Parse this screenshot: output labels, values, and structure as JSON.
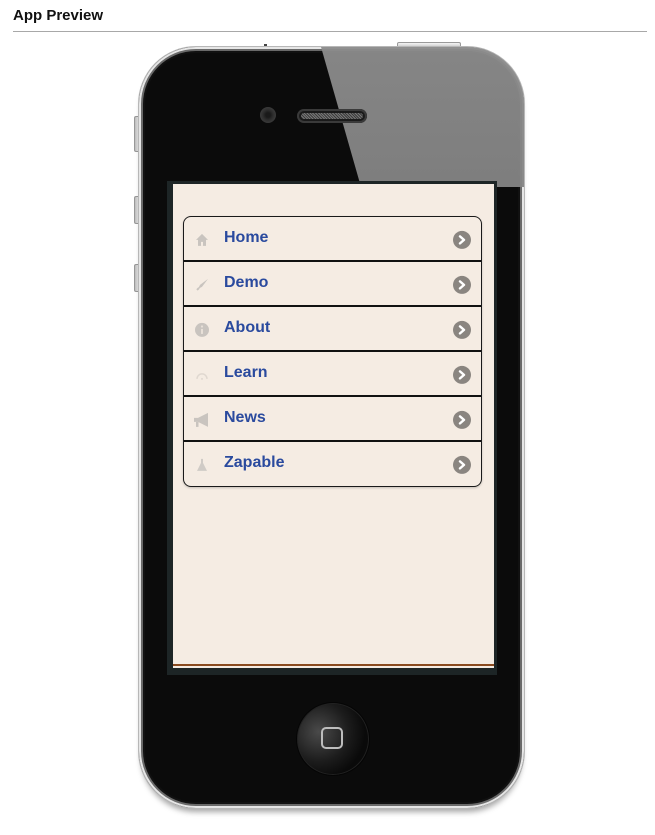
{
  "header": {
    "title": "App Preview"
  },
  "device": {
    "type": "iphone",
    "screen_background": "#f5ece3",
    "accent_line_color": "#8a4a1f"
  },
  "menu": {
    "label_color": "#2a4a9e",
    "items": [
      {
        "label": "Home",
        "icon": "home-icon"
      },
      {
        "label": "Demo",
        "icon": "rocket-icon"
      },
      {
        "label": "About",
        "icon": "info-icon"
      },
      {
        "label": "Learn",
        "icon": "gauge-icon"
      },
      {
        "label": "News",
        "icon": "megaphone-icon"
      },
      {
        "label": "Zapable",
        "icon": "flask-icon"
      }
    ],
    "arrow_icon": "chevron-right-circle-icon"
  }
}
